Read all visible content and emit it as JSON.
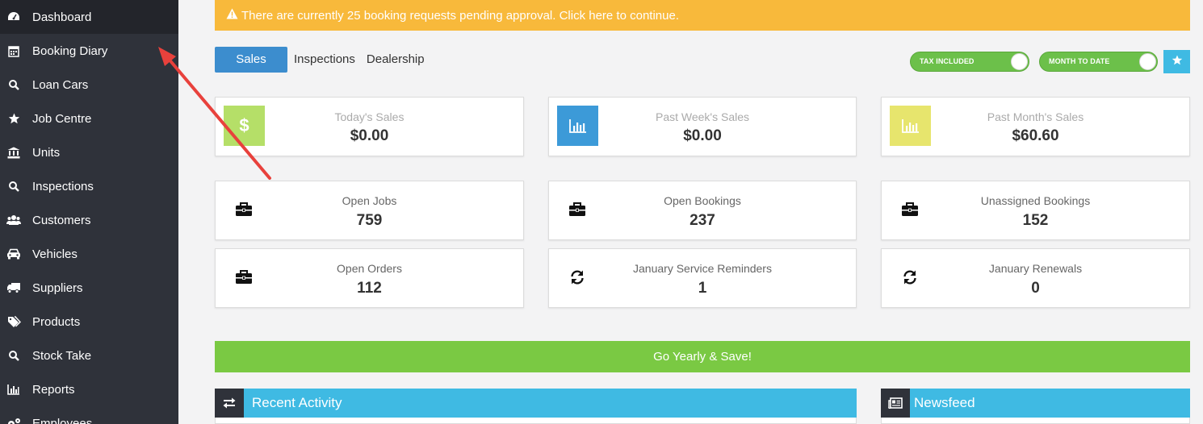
{
  "sidebar": {
    "items": [
      {
        "label": "Dashboard",
        "icon": "dashboard-icon",
        "active": true
      },
      {
        "label": "Booking Diary",
        "icon": "calendar-icon"
      },
      {
        "label": "Loan Cars",
        "icon": "search-icon"
      },
      {
        "label": "Job Centre",
        "icon": "star-icon"
      },
      {
        "label": "Units",
        "icon": "bank-icon"
      },
      {
        "label": "Inspections",
        "icon": "search-icon"
      },
      {
        "label": "Customers",
        "icon": "users-icon"
      },
      {
        "label": "Vehicles",
        "icon": "car-icon"
      },
      {
        "label": "Suppliers",
        "icon": "truck-icon"
      },
      {
        "label": "Products",
        "icon": "tags-icon"
      },
      {
        "label": "Stock Take",
        "icon": "search-icon"
      },
      {
        "label": "Reports",
        "icon": "bar-chart-icon"
      },
      {
        "label": "Employees",
        "icon": "gears-icon"
      }
    ]
  },
  "alert": {
    "text": "There are currently 25 booking requests pending approval. Click here to continue.",
    "icon": "warning-icon"
  },
  "tabs": [
    {
      "label": "Sales",
      "active": true
    },
    {
      "label": "Inspections"
    },
    {
      "label": "Dealership"
    }
  ],
  "toggles": {
    "tax": {
      "label": "TAX INCLUDED",
      "on": true
    },
    "period": {
      "label": "MONTH TO DATE",
      "on": true
    }
  },
  "star_button": {
    "icon": "star-icon"
  },
  "sales_cards": [
    {
      "label": "Today's Sales",
      "value": "$0.00",
      "icon": "dollar-icon",
      "icon_color": "#b5df68"
    },
    {
      "label": "Past Week's Sales",
      "value": "$0.00",
      "icon": "bar-chart-icon",
      "icon_color": "#3c9ad8"
    },
    {
      "label": "Past Month's Sales",
      "value": "$60.60",
      "icon": "bar-chart-icon",
      "icon_color": "#e7e56d"
    }
  ],
  "stat_cards": [
    {
      "label": "Open Jobs",
      "value": "759",
      "icon": "briefcase-icon"
    },
    {
      "label": "Open Bookings",
      "value": "237",
      "icon": "briefcase-icon"
    },
    {
      "label": "Unassigned Bookings",
      "value": "152",
      "icon": "briefcase-icon"
    },
    {
      "label": "Open Orders",
      "value": "112",
      "icon": "briefcase-icon"
    },
    {
      "label": "January Service Reminders",
      "value": "1",
      "icon": "refresh-icon"
    },
    {
      "label": "January Renewals",
      "value": "0",
      "icon": "refresh-icon"
    }
  ],
  "yearly_banner": {
    "text": "Go Yearly & Save!"
  },
  "panels": [
    {
      "title": "Recent Activity",
      "icon": "exchange-icon"
    },
    {
      "title": "Newsfeed",
      "icon": "newspaper-icon"
    }
  ],
  "colors": {
    "sidebar_bg": "#2f323a",
    "alert_bg": "#f8b93b",
    "tab_active": "#3c8dce",
    "toggle_green": "#6cc04a",
    "accent_blue": "#3fbae3",
    "banner_green": "#7ac943",
    "annotation_arrow": "#e8413c"
  }
}
